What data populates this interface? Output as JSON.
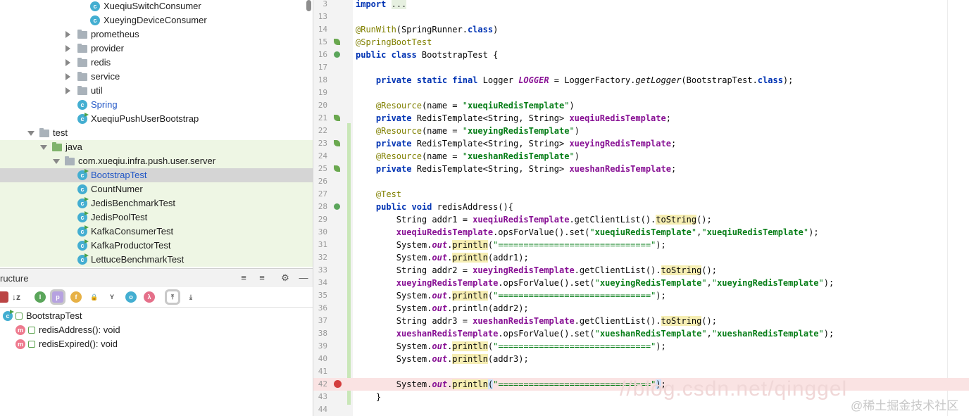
{
  "project_tree": {
    "rows": [
      {
        "label": "XueqiuSwitchConsumer",
        "icon": "class-icon",
        "indent": 129,
        "arrow": ""
      },
      {
        "label": "XueyingDeviceConsumer",
        "icon": "class-icon",
        "indent": 129,
        "arrow": ""
      },
      {
        "label": "prometheus",
        "icon": "folder-icon",
        "indent": 111,
        "arrow": "right"
      },
      {
        "label": "provider",
        "icon": "folder-icon",
        "indent": 111,
        "arrow": "right"
      },
      {
        "label": "redis",
        "icon": "folder-icon",
        "indent": 111,
        "arrow": "right"
      },
      {
        "label": "service",
        "icon": "folder-icon",
        "indent": 111,
        "arrow": "right"
      },
      {
        "label": "util",
        "icon": "folder-icon",
        "indent": 111,
        "arrow": "right"
      },
      {
        "label": "Spring",
        "icon": "spring-class-icon",
        "indent": 111,
        "arrow": "",
        "blue": true
      },
      {
        "label": "XueqiuPushUserBootstrap",
        "icon": "runnable-class-icon",
        "indent": 111,
        "arrow": ""
      },
      {
        "label": "test",
        "icon": "folder-icon",
        "indent": 57,
        "arrow": "down"
      },
      {
        "label": "java",
        "icon": "test-folder-icon",
        "indent": 75,
        "arrow": "down",
        "green": true
      },
      {
        "label": "com.xueqiu.infra.push.user.server",
        "icon": "package-icon",
        "indent": 93,
        "arrow": "down",
        "green": true
      },
      {
        "label": "BootstrapTest",
        "icon": "runnable-class-icon",
        "indent": 111,
        "arrow": "",
        "selected": true,
        "blue": true
      },
      {
        "label": "CountNumer",
        "icon": "class-icon",
        "indent": 111,
        "arrow": "",
        "green": true
      },
      {
        "label": "JedisBenchmarkTest",
        "icon": "runnable-class-icon",
        "indent": 111,
        "arrow": "",
        "green": true
      },
      {
        "label": "JedisPoolTest",
        "icon": "runnable-class-icon",
        "indent": 111,
        "arrow": "",
        "green": true
      },
      {
        "label": "KafkaConsumerTest",
        "icon": "runnable-class-icon",
        "indent": 111,
        "arrow": "",
        "green": true
      },
      {
        "label": "KafkaProductorTest",
        "icon": "runnable-class-icon",
        "indent": 111,
        "arrow": "",
        "green": true
      },
      {
        "label": "LettuceBenchmarkTest",
        "icon": "runnable-class-icon",
        "indent": 111,
        "arrow": "",
        "green": true
      }
    ]
  },
  "structure": {
    "title": "ructure",
    "root": "BootstrapTest",
    "methods": [
      "redisAddress(): void",
      "redisExpired(): void"
    ]
  },
  "editor": {
    "lines": [
      {
        "n": "3",
        "html": "<span class=\"kw\">import</span> <span class=\"fold-import\">...</span>"
      },
      {
        "n": "13",
        "html": ""
      },
      {
        "n": "14",
        "html": "<span class=\"an\">@RunWith</span>(SpringRunner.<span class=\"kw\">class</span>)"
      },
      {
        "n": "15",
        "html": "<span class=\"an\">@SpringBootTest</span>",
        "gi": "leaf"
      },
      {
        "n": "16",
        "html": "<span class=\"kw\">public class</span> BootstrapTest {",
        "gi": "run"
      },
      {
        "n": "17",
        "html": ""
      },
      {
        "n": "18",
        "html": "    <span class=\"kw\">private static final</span> Logger <span class=\"sf\">LOGGER</span> = LoggerFactory.<span class=\"it\">getLogger</span>(BootstrapTest.<span class=\"kw\">class</span>);"
      },
      {
        "n": "19",
        "html": ""
      },
      {
        "n": "20",
        "html": "    <span class=\"an\">@Resource</span>(name = <span class=\"st\">\"</span><span class=\"sb\">xueqiuRedisTemplate</span><span class=\"st\">\"</span>)"
      },
      {
        "n": "21",
        "html": "    <span class=\"kw\">private</span> RedisTemplate&lt;String, String&gt; <span class=\"fd\">xueqiuRedisTemplate</span>;",
        "gi": "leaf"
      },
      {
        "n": "22",
        "html": "    <span class=\"an\">@Resource</span>(name = <span class=\"st\">\"</span><span class=\"sb\">xueyingRedisTemplate</span><span class=\"st\">\"</span>)"
      },
      {
        "n": "23",
        "html": "    <span class=\"kw\">private</span> RedisTemplate&lt;String, String&gt; <span class=\"fd\">xueyingRedisTemplate</span>;",
        "gi": "leaf"
      },
      {
        "n": "24",
        "html": "    <span class=\"an\">@Resource</span>(name = <span class=\"st\">\"</span><span class=\"sb\">xueshanRedisTemplate</span><span class=\"st\">\"</span>)"
      },
      {
        "n": "25",
        "html": "    <span class=\"kw\">private</span> RedisTemplate&lt;String, String&gt; <span class=\"fd\">xueshanRedisTemplate</span>;",
        "gi": "leaf"
      },
      {
        "n": "26",
        "html": ""
      },
      {
        "n": "27",
        "html": "    <span class=\"an\">@Test</span>"
      },
      {
        "n": "28",
        "html": "    <span class=\"kw\">public void</span> redisAddress(){",
        "gi": "run"
      },
      {
        "n": "29",
        "html": "        String addr1 = <span class=\"fd\">xueqiuRedisTemplate</span>.getClientList().<span class=\"hl\">toString</span>();"
      },
      {
        "n": "30",
        "html": "        <span class=\"fd\">xueqiuRedisTemplate</span>.opsForValue().set(<span class=\"st\">\"</span><span class=\"sb\">xueqiuRedisTemplate</span><span class=\"st\">\"</span>,<span class=\"st\">\"</span><span class=\"sb\">xueqiuRedisTemplate</span><span class=\"st\">\"</span>);"
      },
      {
        "n": "31",
        "html": "        System.<span class=\"sf\">out</span>.<span class=\"hl\">println</span>(<span class=\"st\">\"==============================\"</span>);"
      },
      {
        "n": "32",
        "html": "        System.<span class=\"sf\">out</span>.<span class=\"hl\">println</span>(addr1);"
      },
      {
        "n": "33",
        "html": "        String addr2 = <span class=\"fd\">xueyingRedisTemplate</span>.getClientList().<span class=\"hl\">toString</span>();"
      },
      {
        "n": "34",
        "html": "        <span class=\"fd\">xueyingRedisTemplate</span>.opsForValue().set(<span class=\"st\">\"</span><span class=\"sb\">xueyingRedisTemplate</span><span class=\"st\">\"</span>,<span class=\"st\">\"</span><span class=\"sb\">xueyingRedisTemplate</span><span class=\"st\">\"</span>);"
      },
      {
        "n": "35",
        "html": "        System.<span class=\"sf\">out</span>.<span class=\"hl\">println</span>(<span class=\"st\">\"==============================\"</span>);"
      },
      {
        "n": "36",
        "html": "        System.<span class=\"sf\">out</span>.println(addr2);"
      },
      {
        "n": "37",
        "html": "        String addr3 = <span class=\"fd\">xueshanRedisTemplate</span>.getClientList().<span class=\"hl\">toString</span>();"
      },
      {
        "n": "38",
        "html": "        <span class=\"fd\">xueshanRedisTemplate</span>.opsForValue().set(<span class=\"st\">\"</span><span class=\"sb\">xueshanRedisTemplate</span><span class=\"st\">\"</span>,<span class=\"st\">\"</span><span class=\"sb\">xueshanRedisTemplate</span><span class=\"st\">\"</span>);"
      },
      {
        "n": "39",
        "html": "        System.<span class=\"sf\">out</span>.<span class=\"hl\">println</span>(<span class=\"st\">\"==============================\"</span>);"
      },
      {
        "n": "40",
        "html": "        System.<span class=\"sf\">out</span>.<span class=\"hl\">println</span>(addr3);"
      },
      {
        "n": "41",
        "html": ""
      },
      {
        "n": "42",
        "html": "        System.<span class=\"sf\">out</span>.<span class=\"hl\">println</span><span class=\"cursor-sel\">(</span><span class=\"st\">\"==============================\"</span><span class=\"cursor-sel\">)</span>;",
        "gi": "bpdot",
        "bp": true
      },
      {
        "n": "43",
        "html": "    }"
      },
      {
        "n": "44",
        "html": ""
      }
    ]
  },
  "watermark": "@稀土掘金技术社区",
  "blog_watermark": "//blog.csdn.net/qinggel"
}
